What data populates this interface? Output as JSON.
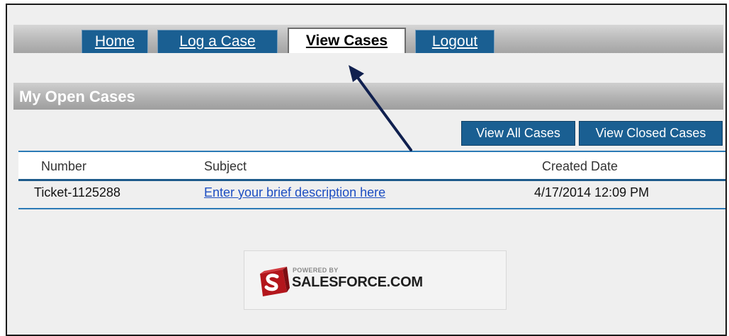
{
  "nav": {
    "tabs": [
      {
        "label": "Home"
      },
      {
        "label": "Log a Case"
      },
      {
        "label": "View Cases"
      },
      {
        "label": "Logout"
      }
    ],
    "active_tab": "View Cases"
  },
  "section": {
    "title": "My Open Cases"
  },
  "actions": {
    "view_all_label": "View All Cases",
    "view_closed_label": "View Closed Cases"
  },
  "table": {
    "columns": [
      "Number",
      "Subject",
      "Created Date"
    ],
    "rows": [
      {
        "number": "Ticket-1125288",
        "subject": "Enter your brief description here",
        "created_date": "4/17/2014 12:09 PM"
      }
    ]
  },
  "footer": {
    "powered_by": "POWERED BY",
    "brand": "SALESFORCE.COM",
    "logo_icon": "salesforce-logo-icon"
  },
  "colors": {
    "tab_blue": "#1a5f92",
    "link_blue": "#1d4ec2",
    "rule_blue": "#2b7ab6",
    "arrow_navy": "#10204f"
  }
}
